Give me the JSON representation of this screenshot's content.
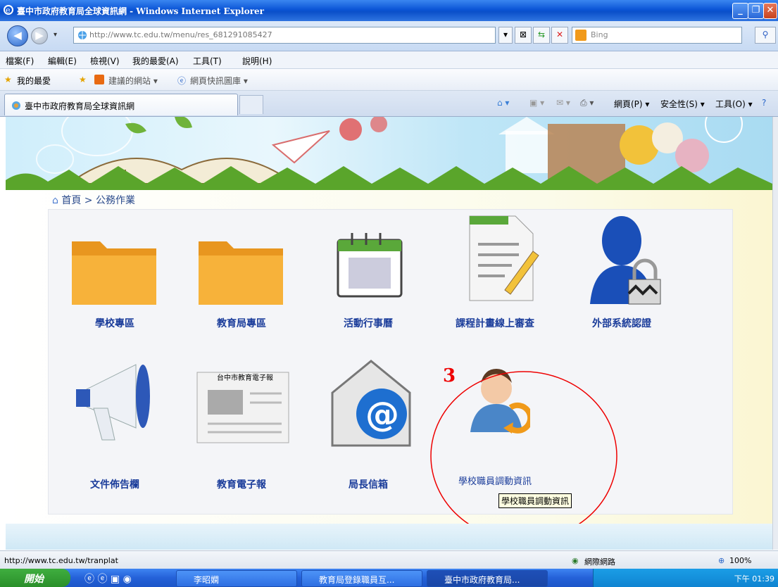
{
  "window": {
    "title": "臺中市政府教育局全球資訊網 - Windows Internet Explorer"
  },
  "address": {
    "url": "http://www.tc.edu.tw/menu/res_681291085427",
    "search_placeholder": "Bing"
  },
  "menu": [
    "檔案(F)",
    "編輯(E)",
    "檢視(V)",
    "我的最愛(A)",
    "工具(T)",
    "說明(H)"
  ],
  "favorites": {
    "label": "我的最愛",
    "items": [
      "建議的網站 ▾",
      "網頁快訊圖庫 ▾"
    ]
  },
  "tab": {
    "title": "臺中市政府教育局全球資訊網"
  },
  "commands": [
    "網頁(P) ▾",
    "安全性(S) ▾",
    "工具(O) ▾"
  ],
  "breadcrumb": "首頁 > 公務作業",
  "tiles_row1": [
    "學校專區",
    "教育局專區",
    "活動行事曆",
    "課程計畫線上審查",
    "外部系統認證"
  ],
  "tiles_row2": [
    "文件佈告欄",
    "教育電子報",
    "局長信箱",
    "學校職員調動資訊"
  ],
  "newspaper_title": "台中市教育電子報",
  "tooltip": "學校職員調動資訊",
  "marker": "3",
  "status": {
    "url": "http://www.tc.edu.tw/tranplat",
    "zone": "網際網路",
    "zoom": "100%"
  },
  "taskbar": {
    "start": "開始",
    "items": [
      "李昭嫻",
      "教育局登錄職員互...",
      "臺中市政府教育局..."
    ],
    "clock": "下午 01:39"
  }
}
